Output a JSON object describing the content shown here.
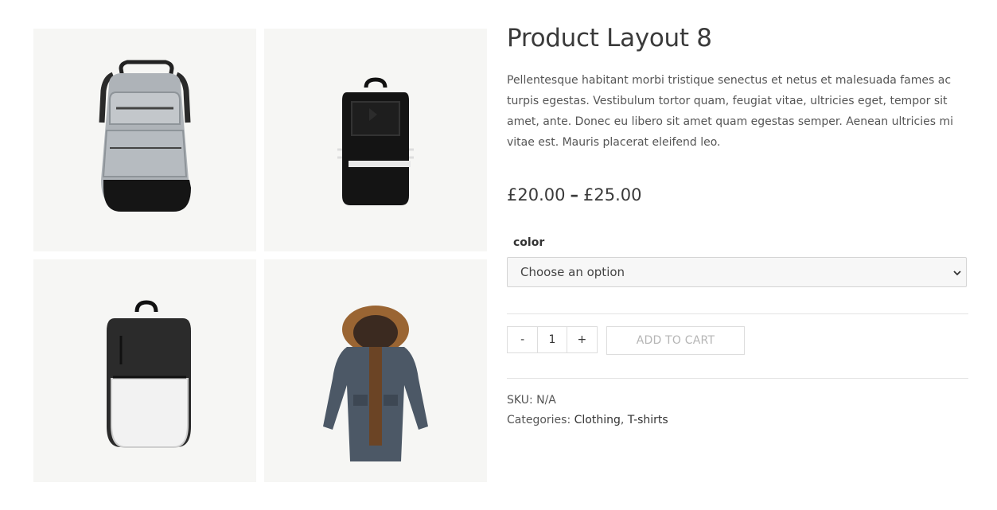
{
  "gallery": {
    "images": [
      {
        "name": "grey backpack",
        "icon": "backpack-grey-image"
      },
      {
        "name": "black backpack with stripes",
        "icon": "backpack-black-striped-image"
      },
      {
        "name": "black and white backpack",
        "icon": "backpack-black-white-image"
      },
      {
        "name": "parka with fur hood",
        "icon": "parka-jacket-image"
      }
    ]
  },
  "product": {
    "title": "Product Layout 8",
    "description": "Pellentesque habitant morbi tristique senectus et netus et malesuada fames ac turpis egestas. Vestibulum tortor quam, feugiat vitae, ultricies eget, tempor sit amet, ante. Donec eu libero sit amet quam egestas semper. Aenean ultricies mi vitae est. Mauris placerat eleifend leo.",
    "price_low": "£20.00",
    "price_sep": "–",
    "price_high": "£25.00"
  },
  "variation": {
    "label": "color",
    "selected": "Choose an option"
  },
  "cart": {
    "minus": "-",
    "quantity": "1",
    "plus": "+",
    "add_label": "ADD TO CART"
  },
  "meta": {
    "sku_label": "SKU:",
    "sku_value": "N/A",
    "categories_label": "Categories:",
    "categories": [
      "Clothing",
      "T-shirts"
    ],
    "separator": ","
  },
  "colors": {
    "tile_bg": "#f6f6f4",
    "text": "#333333",
    "muted": "#b5b5b5",
    "border": "#dddddd"
  }
}
